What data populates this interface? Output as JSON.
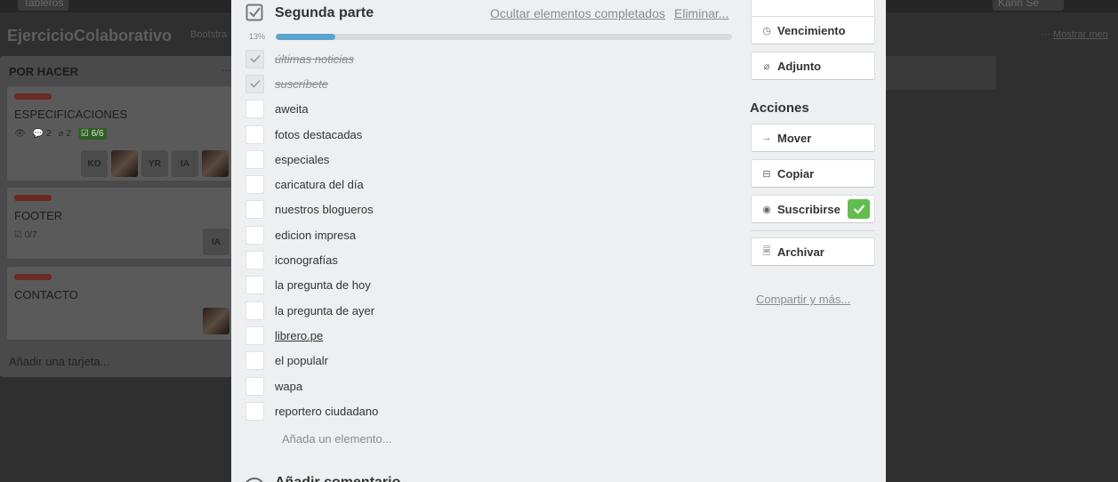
{
  "board": {
    "title": "EjercicioColaborativo",
    "team": "Bootstra",
    "show_menu": "Mostrar men",
    "top_buttons": [
      "Tableros",
      "Karin Se"
    ],
    "list": {
      "title": "POR HACER",
      "cards": [
        {
          "title": "ESPECIFICACIONES",
          "watch": "",
          "comments": "2",
          "attachments": "2",
          "checklist": "6/6",
          "members": [
            "KO",
            "",
            "YR",
            "IA",
            ""
          ]
        },
        {
          "title": "FOOTER",
          "checklist": "0/7",
          "members": [
            "IA"
          ]
        },
        {
          "title": "CONTACTO",
          "members": [
            ""
          ]
        }
      ],
      "add_card": "Añadir una tarjeta..."
    }
  },
  "checklist": {
    "title": "Segunda parte",
    "hide_completed": "Ocultar elementos completados",
    "delete": "Eliminar...",
    "progress_label": "13%",
    "progress": 0.13,
    "items": [
      {
        "text": "últimas noticias",
        "done": true
      },
      {
        "text": "suscríbete",
        "done": true
      },
      {
        "text": "aweita",
        "done": false
      },
      {
        "text": "fotos destacadas",
        "done": false
      },
      {
        "text": "especiales",
        "done": false
      },
      {
        "text": "caricatura del día",
        "done": false
      },
      {
        "text": "nuestros blogueros",
        "done": false
      },
      {
        "text": "edicion impresa",
        "done": false
      },
      {
        "text": "iconografías",
        "done": false
      },
      {
        "text": "la pregunta de hoy",
        "done": false
      },
      {
        "text": "la pregunta de ayer",
        "done": false
      },
      {
        "text": "librero.pe",
        "done": false
      },
      {
        "text": "el populalr",
        "done": false
      },
      {
        "text": "wapa",
        "done": false
      },
      {
        "text": "reportero ciudadano",
        "done": false
      }
    ],
    "add_item": "Añada un elemento..."
  },
  "activity": {
    "title": "Añadir comentario"
  },
  "sidebar": {
    "due": "Vencimiento",
    "attachment": "Adjunto",
    "actions_title": "Acciones",
    "move": "Mover",
    "copy": "Copiar",
    "subscribe": "Suscribirse",
    "archive": "Archivar",
    "share": "Compartir y más..."
  },
  "colors": {
    "progress": "#5ba4cf",
    "subscribed": "#61bd4f",
    "label_red": "#eb5a46"
  }
}
